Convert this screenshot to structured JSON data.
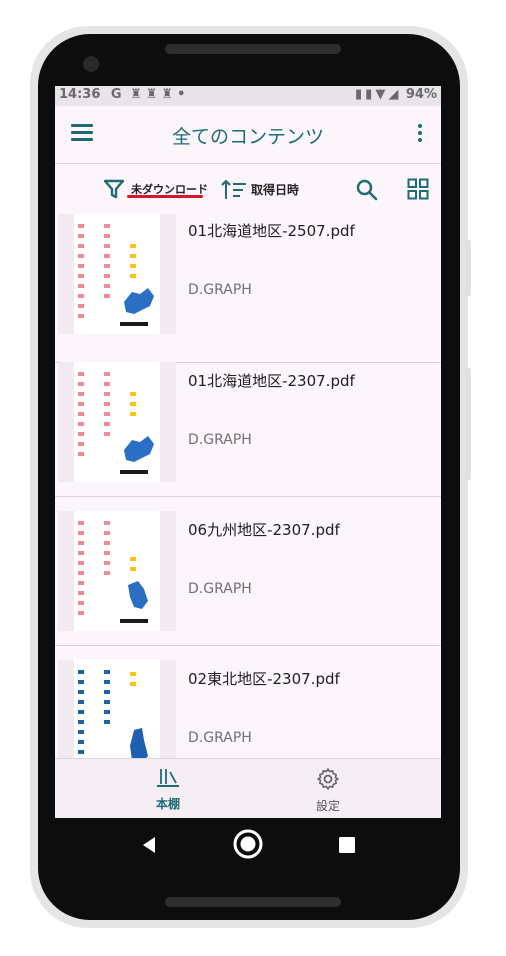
{
  "status_bar": {
    "time": "14:36",
    "indicators": "G",
    "battery": "94%"
  },
  "app_bar": {
    "title": "全てのコンテンツ",
    "menu_icon": "hamburger-menu-icon",
    "more_icon": "more-vert-icon"
  },
  "toolbar": {
    "filter_label": "未ダウンロード",
    "sort_label": "取得日時",
    "accent_color": "#1d6b73",
    "underline_color": "#d9142b"
  },
  "items": [
    {
      "title": "01北海道地区-2507.pdf",
      "author": "D.GRAPH",
      "thumb_variant": "hokkaido"
    },
    {
      "title": "01北海道地区-2307.pdf",
      "author": "D.GRAPH",
      "thumb_variant": "hokkaido"
    },
    {
      "title": "06九州地区-2307.pdf",
      "author": "D.GRAPH",
      "thumb_variant": "kyushu"
    },
    {
      "title": "02東北地区-2307.pdf",
      "author": "D.GRAPH",
      "thumb_variant": "tohoku"
    }
  ],
  "bottom_nav": [
    {
      "label": "本棚",
      "icon": "bookshelf-icon",
      "active": true
    },
    {
      "label": "設定",
      "icon": "gear-icon",
      "active": false
    }
  ]
}
